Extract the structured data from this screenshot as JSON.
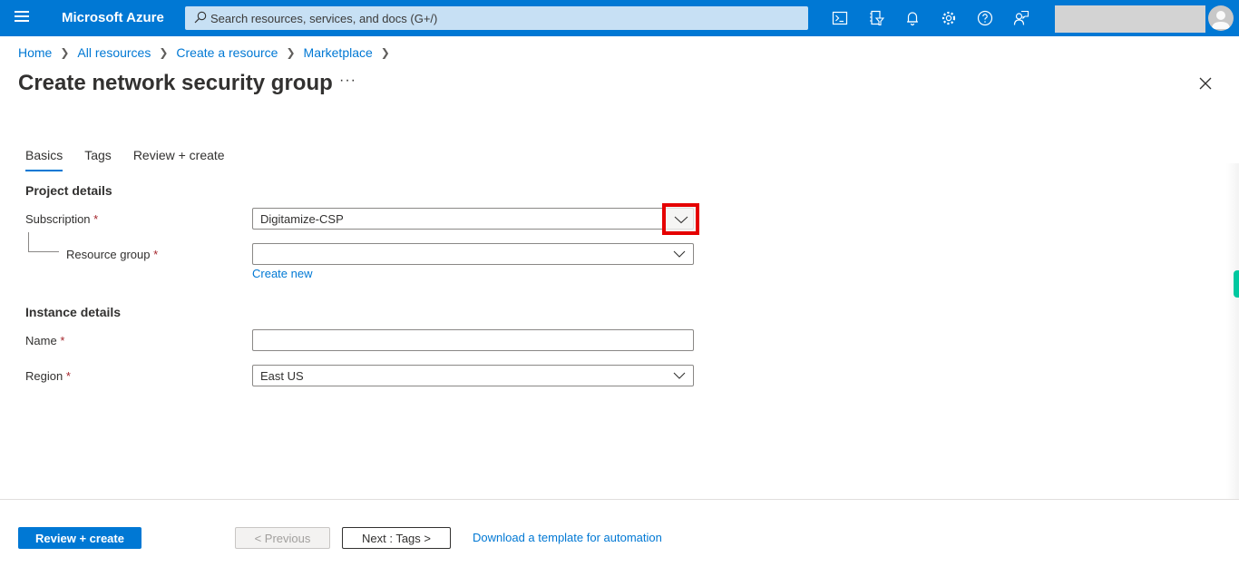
{
  "topbar": {
    "brand": "Microsoft Azure",
    "search_placeholder": "Search resources, services, and docs (G+/)",
    "icons": [
      "cloud-shell-icon",
      "directory-filter-icon",
      "notifications-icon",
      "settings-icon",
      "help-icon",
      "feedback-icon"
    ],
    "accent_color": "#0078d4"
  },
  "breadcrumb": [
    {
      "label": "Home"
    },
    {
      "label": "All resources"
    },
    {
      "label": "Create a resource"
    },
    {
      "label": "Marketplace"
    }
  ],
  "page": {
    "title": "Create network security group",
    "more_label": "···"
  },
  "tabs": [
    {
      "label": "Basics",
      "active": true
    },
    {
      "label": "Tags",
      "active": false
    },
    {
      "label": "Review + create",
      "active": false
    }
  ],
  "form": {
    "project_details": "Project details",
    "subscription_label": "Subscription",
    "subscription_value": "Digitamize-CSP",
    "resource_group_label": "Resource group",
    "resource_group_value": "",
    "create_new": "Create new",
    "instance_details": "Instance details",
    "name_label": "Name",
    "name_value": "",
    "region_label": "Region",
    "region_value": "East US",
    "required_marker": "*"
  },
  "footer": {
    "review_create": "Review + create",
    "previous": "< Previous",
    "next": "Next : Tags >",
    "download_template": "Download a template for automation"
  }
}
